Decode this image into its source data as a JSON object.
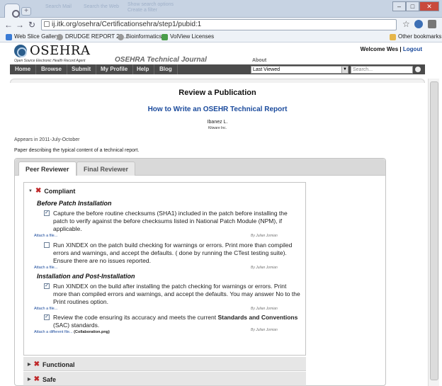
{
  "browser": {
    "tab_faint_1": "Search Mail",
    "tab_faint_2": "Search the Web",
    "tab_faint_3": "Show search options",
    "tab_faint_4": "Create a filter",
    "url": "ij.itk.org/osehra/Certificationsehra/step1/pubid:1",
    "bookmarks": [
      "Web Slice Gallery",
      "DRUDGE REPORT 20...",
      "Bioinformatics",
      "VolView Licenses"
    ],
    "other_bookmarks": "Other bookmarks",
    "min": "–",
    "max": "□",
    "close": "✕"
  },
  "site": {
    "logo": "OSEHRA",
    "logo_sub": "Open Source Electronic Health Record Agent",
    "journal": "OSEHRA Technical Journal",
    "about": "About",
    "welcome": "Welcome Wes",
    "separator": "|",
    "logout": "Logout"
  },
  "nav": [
    "Home",
    "Browse",
    "Submit",
    "My Profile",
    "Help",
    "Blog"
  ],
  "last_viewed": "Last Viewed",
  "search_placeholder": "Search...",
  "page": {
    "heading": "Review a Publication",
    "title": "How to Write an OSEHR Technical Report",
    "author": "Ibanez L.",
    "institution": "Kitware Inc.",
    "appears": "Appears in 2011-July-October",
    "description": "Paper describing the typical content of a technical report."
  },
  "tabs": [
    "Peer Reviewer",
    "Final Reviewer"
  ],
  "compliant": {
    "title": "Compliant",
    "sub1": "Before Patch Installation",
    "sub2": "Installation and Post-Installation",
    "item1": "Capture the before routine checksums (SHA1) included in the patch before installing the patch to verify against the before checksums listed in National Patch Module (NPM), if applicable.",
    "item2": "Run XINDEX on the patch build checking for warnings or errors. Print more than compiled errors and warnings, and accept the defaults. ( done by running the CTest testing suite). Ensure there are no issues reported.",
    "item3": "Run XINDEX on the build after installing the patch checking for warnings or errors. Print more than compiled errors and warnings, and accept the defaults. You may answer No to the Print routines option.",
    "item4_a": "Review the code ensuring its accuracy and meets the current ",
    "item4_b": "Standards and Conventions",
    "item4_c": " (SAC) standards.",
    "checked": [
      true,
      false,
      true,
      true
    ],
    "attach": "Attach a file...",
    "attach_diff": "Attach a different file...",
    "attach_file": "(Collaboration.png)",
    "by": "By Julian Jomian"
  },
  "functional": "Functional",
  "safe": "Safe"
}
